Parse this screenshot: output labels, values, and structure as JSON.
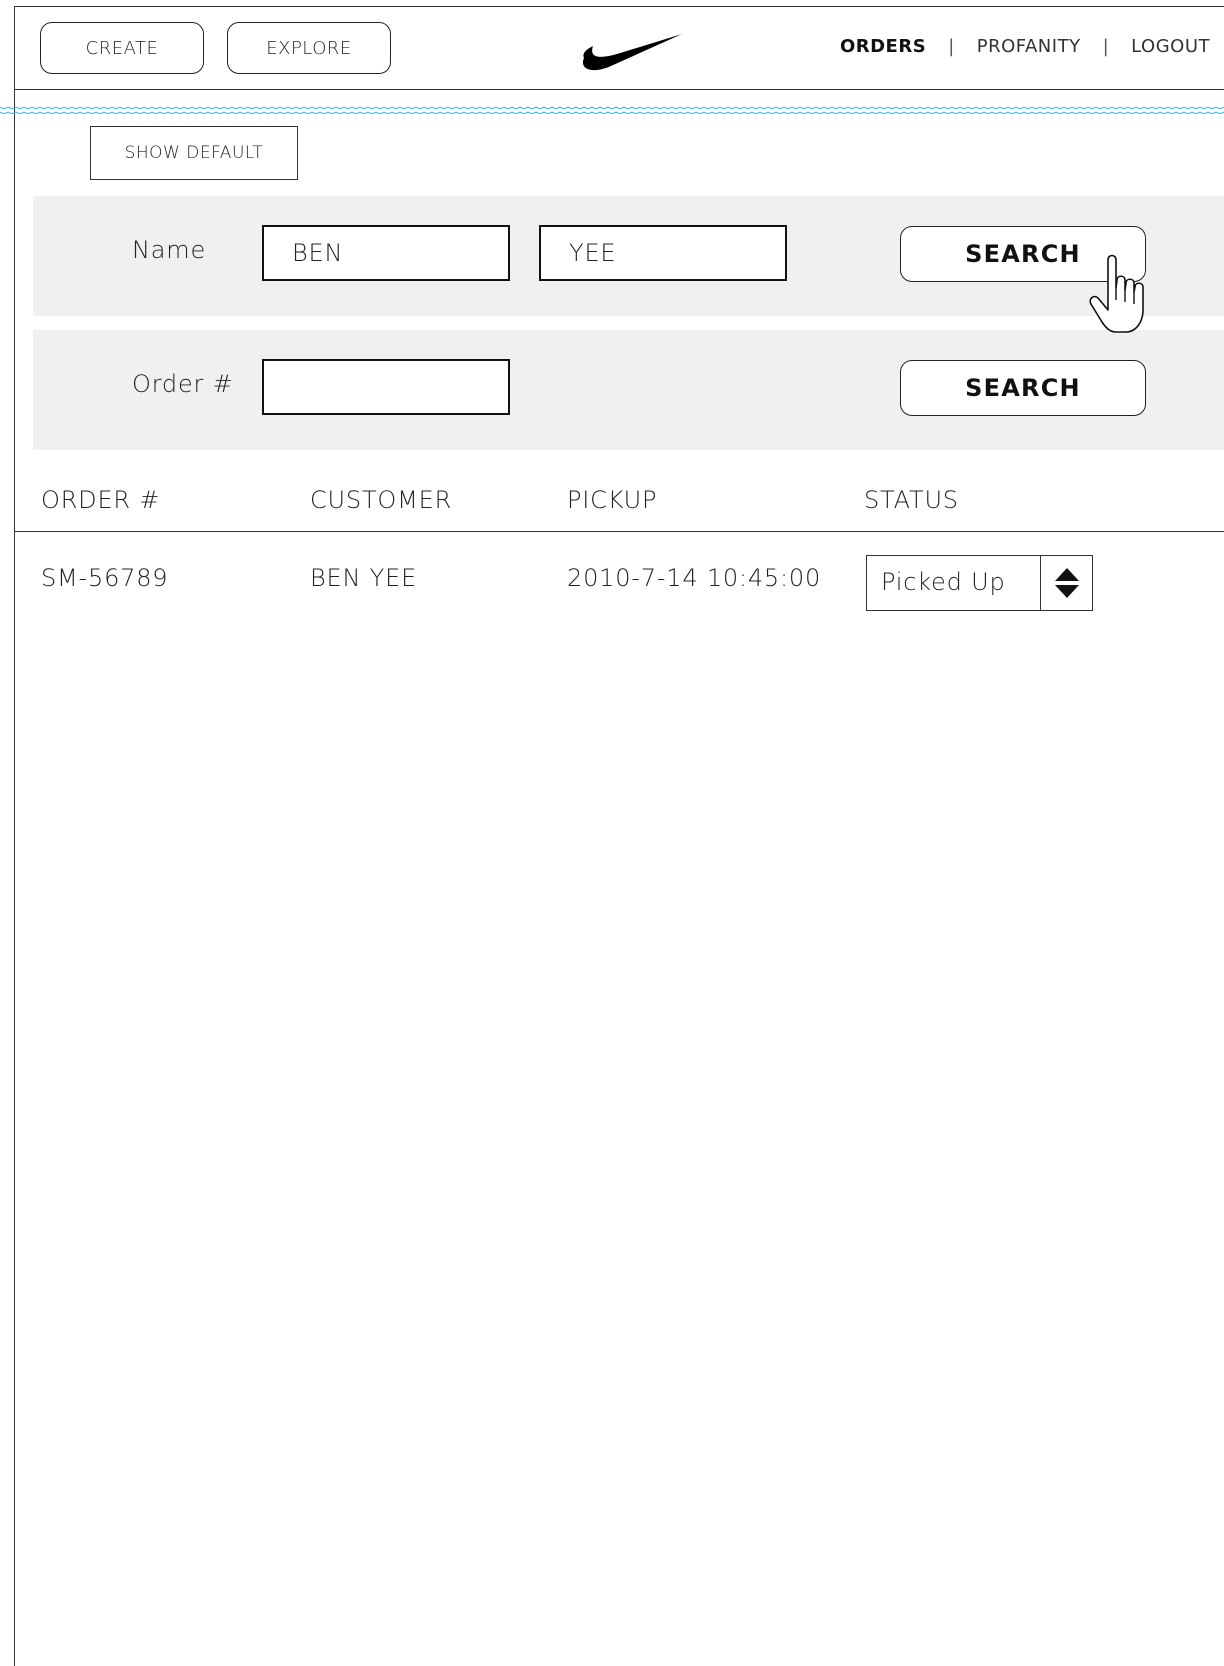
{
  "header": {
    "create_label": "CREATE",
    "explore_label": "EXPLORE",
    "logo_icon": "swoosh-logo",
    "nav": {
      "orders": "ORDERS",
      "profanity": "PROFANITY",
      "logout": "LOGOUT",
      "separator": "|"
    }
  },
  "toolbar": {
    "show_default_label": "SHOW DEFAULT"
  },
  "name_search": {
    "label": "Name",
    "first_name_value": "BEN",
    "last_name_value": "YEE",
    "button_label": "SEARCH"
  },
  "order_search": {
    "label": "Order #",
    "order_value": "",
    "button_label": "SEARCH"
  },
  "table": {
    "columns": [
      "ORDER #",
      "CUSTOMER",
      "PICKUP",
      "STATUS"
    ],
    "rows": [
      {
        "order": "SM-56789",
        "customer": "BEN YEE",
        "pickup": "2010-7-14 10:45:00",
        "status": "Picked Up"
      }
    ]
  },
  "colors": {
    "panel_bg": "#f0f0f0",
    "wave": "#29b6e8",
    "border": "#333333"
  },
  "icons": {
    "cursor": "hand-pointer-icon",
    "stepper": "up-down-arrows-icon"
  }
}
